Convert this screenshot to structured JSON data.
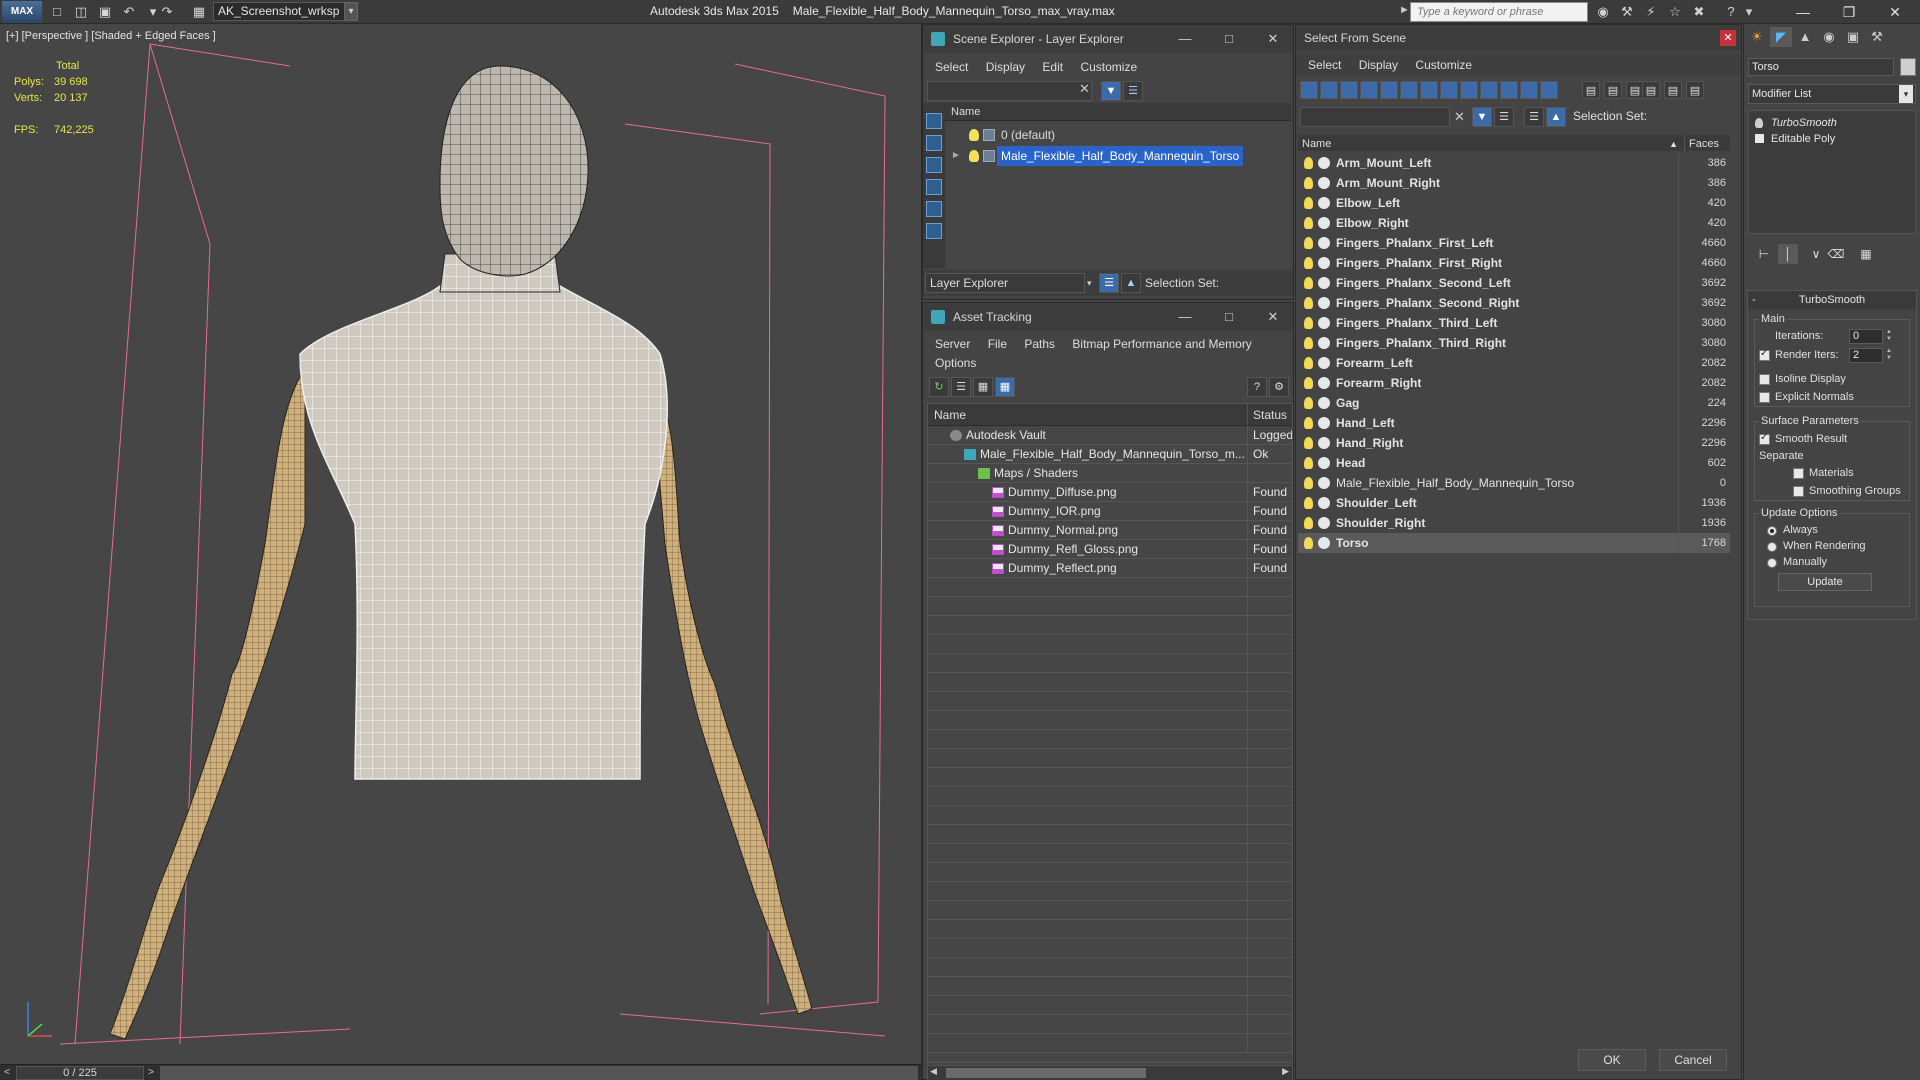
{
  "titlebar": {
    "workspace": "AK_Screenshot_wrksp",
    "app_name": "Autodesk 3ds Max  2015",
    "file_name": "Male_Flexible_Half_Body_Mannequin_Torso_max_vray.max",
    "search_placeholder": "Type a keyword or phrase",
    "logo": "MAX"
  },
  "viewport": {
    "label": "[+] [Perspective ] [Shaded + Edged Faces ]",
    "stats": {
      "total_label": "Total",
      "polys_label": "Polys:",
      "polys_value": "39 698",
      "verts_label": "Verts:",
      "verts_value": "20 137",
      "fps_label": "FPS:",
      "fps_value": "742,225"
    }
  },
  "timebar": {
    "frame_label": "0 / 225",
    "left_arrow": "<",
    "right_arrow": ">"
  },
  "scene_explorer": {
    "title": "Scene Explorer - Layer Explorer",
    "menu": [
      "Select",
      "Display",
      "Edit",
      "Customize"
    ],
    "column_name": "Name",
    "layers": [
      {
        "name": "0 (default)",
        "selected": false
      },
      {
        "name": "Male_Flexible_Half_Body_Mannequin_Torso",
        "selected": true
      }
    ],
    "explorer_combo": "Layer Explorer",
    "selection_set_label": "Selection Set:"
  },
  "asset_tracking": {
    "title": "Asset Tracking",
    "menu": [
      "Server",
      "File",
      "Paths",
      "Bitmap Performance and Memory",
      "Options"
    ],
    "col_name": "Name",
    "col_status": "Status",
    "rows": [
      {
        "name": "Autodesk Vault",
        "status": "Logged",
        "indent": 1,
        "icon": "vault"
      },
      {
        "name": "Male_Flexible_Half_Body_Mannequin_Torso_m...",
        "status": "Ok",
        "indent": 2,
        "icon": "max"
      },
      {
        "name": "Maps / Shaders",
        "status": "",
        "indent": 3,
        "icon": "maps"
      },
      {
        "name": "Dummy_Diffuse.png",
        "status": "Found",
        "indent": 4,
        "icon": "png"
      },
      {
        "name": "Dummy_IOR.png",
        "status": "Found",
        "indent": 4,
        "icon": "png"
      },
      {
        "name": "Dummy_Normal.png",
        "status": "Found",
        "indent": 4,
        "icon": "png"
      },
      {
        "name": "Dummy_Refl_Gloss.png",
        "status": "Found",
        "indent": 4,
        "icon": "png"
      },
      {
        "name": "Dummy_Reflect.png",
        "status": "Found",
        "indent": 4,
        "icon": "png"
      }
    ]
  },
  "select_from_scene": {
    "title": "Select From Scene",
    "menu": [
      "Select",
      "Display",
      "Customize"
    ],
    "selection_set_label": "Selection Set:",
    "col_name": "Name",
    "col_faces": "Faces",
    "objects": [
      {
        "name": "Arm_Mount_Left",
        "faces": "386",
        "bold": true
      },
      {
        "name": "Arm_Mount_Right",
        "faces": "386",
        "bold": true
      },
      {
        "name": "Elbow_Left",
        "faces": "420",
        "bold": true
      },
      {
        "name": "Elbow_Right",
        "faces": "420",
        "bold": true
      },
      {
        "name": "Fingers_Phalanx_First_Left",
        "faces": "4660",
        "bold": true
      },
      {
        "name": "Fingers_Phalanx_First_Right",
        "faces": "4660",
        "bold": true
      },
      {
        "name": "Fingers_Phalanx_Second_Left",
        "faces": "3692",
        "bold": true
      },
      {
        "name": "Fingers_Phalanx_Second_Right",
        "faces": "3692",
        "bold": true
      },
      {
        "name": "Fingers_Phalanx_Third_Left",
        "faces": "3080",
        "bold": true
      },
      {
        "name": "Fingers_Phalanx_Third_Right",
        "faces": "3080",
        "bold": true
      },
      {
        "name": "Forearm_Left",
        "faces": "2082",
        "bold": true
      },
      {
        "name": "Forearm_Right",
        "faces": "2082",
        "bold": true
      },
      {
        "name": "Gag",
        "faces": "224",
        "bold": true
      },
      {
        "name": "Hand_Left",
        "faces": "2296",
        "bold": true
      },
      {
        "name": "Hand_Right",
        "faces": "2296",
        "bold": true
      },
      {
        "name": "Head",
        "faces": "602",
        "bold": true
      },
      {
        "name": "Male_Flexible_Half_Body_Mannequin_Torso",
        "faces": "0",
        "bold": false
      },
      {
        "name": "Shoulder_Left",
        "faces": "1936",
        "bold": true
      },
      {
        "name": "Shoulder_Right",
        "faces": "1936",
        "bold": true
      },
      {
        "name": "Torso",
        "faces": "1768",
        "bold": true,
        "selected": true
      }
    ],
    "ok_label": "OK",
    "cancel_label": "Cancel"
  },
  "command_panel": {
    "object_name": "Torso",
    "modifier_list": "Modifier List",
    "stack": [
      {
        "name": "TurboSmooth",
        "italic": true
      },
      {
        "name": "Editable Poly",
        "italic": false
      }
    ],
    "turbosmooth": {
      "header": "TurboSmooth",
      "main_label": "Main",
      "iterations_label": "Iterations:",
      "iterations_value": "0",
      "render_iters_label": "Render Iters:",
      "render_iters_value": "2",
      "isoline_label": "Isoline Display",
      "explicit_normals_label": "Explicit Normals",
      "surface_params_label": "Surface Parameters",
      "smooth_result_label": "Smooth Result",
      "separate_label": "Separate",
      "materials_label": "Materials",
      "smoothing_groups_label": "Smoothing Groups",
      "update_options_label": "Update Options",
      "always_label": "Always",
      "when_rendering_label": "When Rendering",
      "manually_label": "Manually",
      "update_button": "Update"
    }
  },
  "colors": {
    "selection_blue": "#2b64c9",
    "stats_yellow": "#e6e64a",
    "bounding_box_pink": "#e86a9a"
  }
}
